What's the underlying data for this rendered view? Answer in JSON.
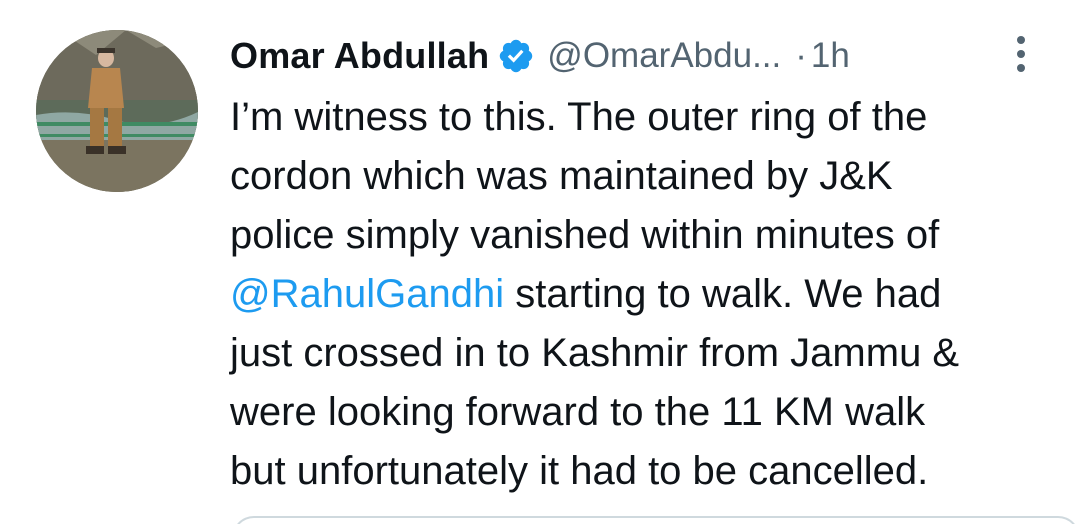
{
  "tweet": {
    "author": {
      "name": "Omar Abdullah",
      "handle": "@OmarAbdu...",
      "verified": true,
      "avatar_icon": "profile-photo"
    },
    "separator": "·",
    "time": "1h",
    "text_lines": [
      "I’m witness to this. The outer ring of the",
      "cordon which was maintained by J&K",
      "police simply vanished within minutes of",
      " starting to walk. We had",
      "just crossed in to Kashmir from Jammu &",
      "were looking forward to the 11 KM walk",
      "but unfortunately it had to be cancelled."
    ],
    "mention": "@RahulGandhi",
    "colors": {
      "text": "#0f1419",
      "secondary": "#536471",
      "link": "#1d9bf0",
      "verified": "#1d9bf0"
    },
    "icons": {
      "verified": "verified-badge-icon",
      "more": "more-vertical-icon"
    }
  }
}
